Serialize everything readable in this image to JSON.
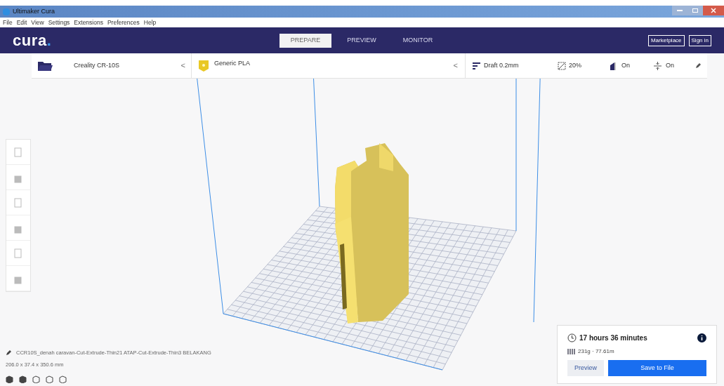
{
  "window": {
    "title": "Ultimaker Cura"
  },
  "menu": [
    "File",
    "Edit",
    "View",
    "Settings",
    "Extensions",
    "Preferences",
    "Help"
  ],
  "header": {
    "logo": "cura",
    "logo_dot": ".",
    "stages": [
      {
        "label": "PREPARE",
        "selected": true
      },
      {
        "label": "PREVIEW",
        "selected": false
      },
      {
        "label": "MONITOR",
        "selected": false
      }
    ],
    "buttons": [
      "Marketplace",
      "Sign in"
    ]
  },
  "toolbar": {
    "printer": "Creality CR-10S",
    "printer_arrow": "<",
    "material": "Generic PLA",
    "material_arrow": "<",
    "profile": "Draft 0.2mm",
    "infill": "20%",
    "support": "On",
    "adhesion": "On"
  },
  "object": {
    "name": "CCR10S_denah caravan-Cut-Extrude-Thin21 ATAP-Cut-Extrude-Thin3 BELAKANG",
    "dimensions": "206.0 x 37.4 x 350.6 mm"
  },
  "estimate": {
    "time": "17 hours 36 minutes",
    "material": "231g · 77.61m",
    "buttons": [
      {
        "kind": "secondary",
        "label": "Preview"
      },
      {
        "kind": "primary",
        "label": "Save to File"
      }
    ]
  }
}
